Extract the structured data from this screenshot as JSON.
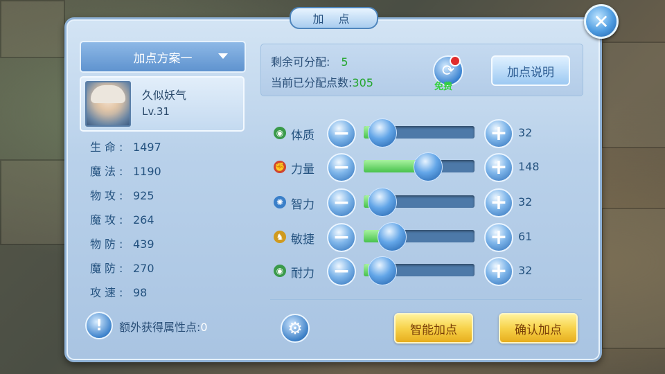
{
  "title": "加 点",
  "close_icon": "close-icon",
  "scheme": {
    "label": "加点方案一"
  },
  "character": {
    "name": "久似妖气",
    "level": "Lv.31"
  },
  "stats": [
    {
      "label": "生命:",
      "value": "1497"
    },
    {
      "label": "魔法:",
      "value": "1190"
    },
    {
      "label": "物攻:",
      "value": "925"
    },
    {
      "label": "魔攻:",
      "value": "264"
    },
    {
      "label": "物防:",
      "value": "439"
    },
    {
      "label": "魔防:",
      "value": "270"
    },
    {
      "label": "攻速:",
      "value": "98"
    }
  ],
  "points": {
    "remaining_label": "剩余可分配:",
    "remaining_value": "5",
    "allocated_label": "当前已分配点数:",
    "allocated_value": "305",
    "reset_free_label": "免费",
    "explain_button": "加点说明"
  },
  "attributes": [
    {
      "name": "体质",
      "value": "32",
      "fill": 0.05,
      "icon": "constitution-icon",
      "color": "#3a9a4a"
    },
    {
      "name": "力量",
      "value": "148",
      "fill": 0.46,
      "icon": "strength-icon",
      "color": "#d0452f"
    },
    {
      "name": "智力",
      "value": "32",
      "fill": 0.05,
      "icon": "intelligence-icon",
      "color": "#3a7fc9"
    },
    {
      "name": "敏捷",
      "value": "61",
      "fill": 0.14,
      "icon": "agility-icon",
      "color": "#d09a1e"
    },
    {
      "name": "耐力",
      "value": "32",
      "fill": 0.05,
      "icon": "endurance-icon",
      "color": "#3a9a4a"
    }
  ],
  "extra": {
    "label": "额外获得属性点:",
    "value": "0"
  },
  "buttons": {
    "smart": "智能加点",
    "confirm": "确认加点"
  }
}
